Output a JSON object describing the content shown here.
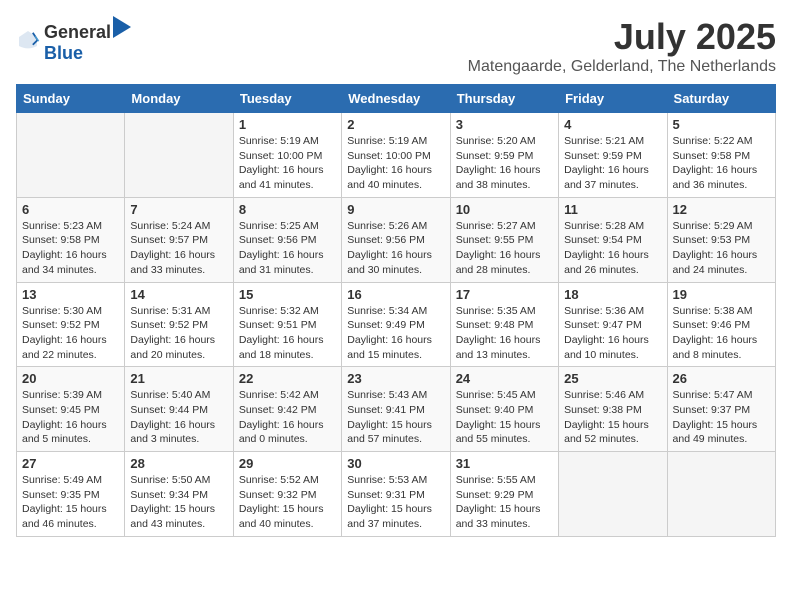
{
  "header": {
    "logo_general": "General",
    "logo_blue": "Blue",
    "month_title": "July 2025",
    "location": "Matengaarde, Gelderland, The Netherlands"
  },
  "weekdays": [
    "Sunday",
    "Monday",
    "Tuesday",
    "Wednesday",
    "Thursday",
    "Friday",
    "Saturday"
  ],
  "weeks": [
    [
      {
        "day": "",
        "info": ""
      },
      {
        "day": "",
        "info": ""
      },
      {
        "day": "1",
        "info": "Sunrise: 5:19 AM\nSunset: 10:00 PM\nDaylight: 16 hours\nand 41 minutes."
      },
      {
        "day": "2",
        "info": "Sunrise: 5:19 AM\nSunset: 10:00 PM\nDaylight: 16 hours\nand 40 minutes."
      },
      {
        "day": "3",
        "info": "Sunrise: 5:20 AM\nSunset: 9:59 PM\nDaylight: 16 hours\nand 38 minutes."
      },
      {
        "day": "4",
        "info": "Sunrise: 5:21 AM\nSunset: 9:59 PM\nDaylight: 16 hours\nand 37 minutes."
      },
      {
        "day": "5",
        "info": "Sunrise: 5:22 AM\nSunset: 9:58 PM\nDaylight: 16 hours\nand 36 minutes."
      }
    ],
    [
      {
        "day": "6",
        "info": "Sunrise: 5:23 AM\nSunset: 9:58 PM\nDaylight: 16 hours\nand 34 minutes."
      },
      {
        "day": "7",
        "info": "Sunrise: 5:24 AM\nSunset: 9:57 PM\nDaylight: 16 hours\nand 33 minutes."
      },
      {
        "day": "8",
        "info": "Sunrise: 5:25 AM\nSunset: 9:56 PM\nDaylight: 16 hours\nand 31 minutes."
      },
      {
        "day": "9",
        "info": "Sunrise: 5:26 AM\nSunset: 9:56 PM\nDaylight: 16 hours\nand 30 minutes."
      },
      {
        "day": "10",
        "info": "Sunrise: 5:27 AM\nSunset: 9:55 PM\nDaylight: 16 hours\nand 28 minutes."
      },
      {
        "day": "11",
        "info": "Sunrise: 5:28 AM\nSunset: 9:54 PM\nDaylight: 16 hours\nand 26 minutes."
      },
      {
        "day": "12",
        "info": "Sunrise: 5:29 AM\nSunset: 9:53 PM\nDaylight: 16 hours\nand 24 minutes."
      }
    ],
    [
      {
        "day": "13",
        "info": "Sunrise: 5:30 AM\nSunset: 9:52 PM\nDaylight: 16 hours\nand 22 minutes."
      },
      {
        "day": "14",
        "info": "Sunrise: 5:31 AM\nSunset: 9:52 PM\nDaylight: 16 hours\nand 20 minutes."
      },
      {
        "day": "15",
        "info": "Sunrise: 5:32 AM\nSunset: 9:51 PM\nDaylight: 16 hours\nand 18 minutes."
      },
      {
        "day": "16",
        "info": "Sunrise: 5:34 AM\nSunset: 9:49 PM\nDaylight: 16 hours\nand 15 minutes."
      },
      {
        "day": "17",
        "info": "Sunrise: 5:35 AM\nSunset: 9:48 PM\nDaylight: 16 hours\nand 13 minutes."
      },
      {
        "day": "18",
        "info": "Sunrise: 5:36 AM\nSunset: 9:47 PM\nDaylight: 16 hours\nand 10 minutes."
      },
      {
        "day": "19",
        "info": "Sunrise: 5:38 AM\nSunset: 9:46 PM\nDaylight: 16 hours\nand 8 minutes."
      }
    ],
    [
      {
        "day": "20",
        "info": "Sunrise: 5:39 AM\nSunset: 9:45 PM\nDaylight: 16 hours\nand 5 minutes."
      },
      {
        "day": "21",
        "info": "Sunrise: 5:40 AM\nSunset: 9:44 PM\nDaylight: 16 hours\nand 3 minutes."
      },
      {
        "day": "22",
        "info": "Sunrise: 5:42 AM\nSunset: 9:42 PM\nDaylight: 16 hours\nand 0 minutes."
      },
      {
        "day": "23",
        "info": "Sunrise: 5:43 AM\nSunset: 9:41 PM\nDaylight: 15 hours\nand 57 minutes."
      },
      {
        "day": "24",
        "info": "Sunrise: 5:45 AM\nSunset: 9:40 PM\nDaylight: 15 hours\nand 55 minutes."
      },
      {
        "day": "25",
        "info": "Sunrise: 5:46 AM\nSunset: 9:38 PM\nDaylight: 15 hours\nand 52 minutes."
      },
      {
        "day": "26",
        "info": "Sunrise: 5:47 AM\nSunset: 9:37 PM\nDaylight: 15 hours\nand 49 minutes."
      }
    ],
    [
      {
        "day": "27",
        "info": "Sunrise: 5:49 AM\nSunset: 9:35 PM\nDaylight: 15 hours\nand 46 minutes."
      },
      {
        "day": "28",
        "info": "Sunrise: 5:50 AM\nSunset: 9:34 PM\nDaylight: 15 hours\nand 43 minutes."
      },
      {
        "day": "29",
        "info": "Sunrise: 5:52 AM\nSunset: 9:32 PM\nDaylight: 15 hours\nand 40 minutes."
      },
      {
        "day": "30",
        "info": "Sunrise: 5:53 AM\nSunset: 9:31 PM\nDaylight: 15 hours\nand 37 minutes."
      },
      {
        "day": "31",
        "info": "Sunrise: 5:55 AM\nSunset: 9:29 PM\nDaylight: 15 hours\nand 33 minutes."
      },
      {
        "day": "",
        "info": ""
      },
      {
        "day": "",
        "info": ""
      }
    ]
  ]
}
